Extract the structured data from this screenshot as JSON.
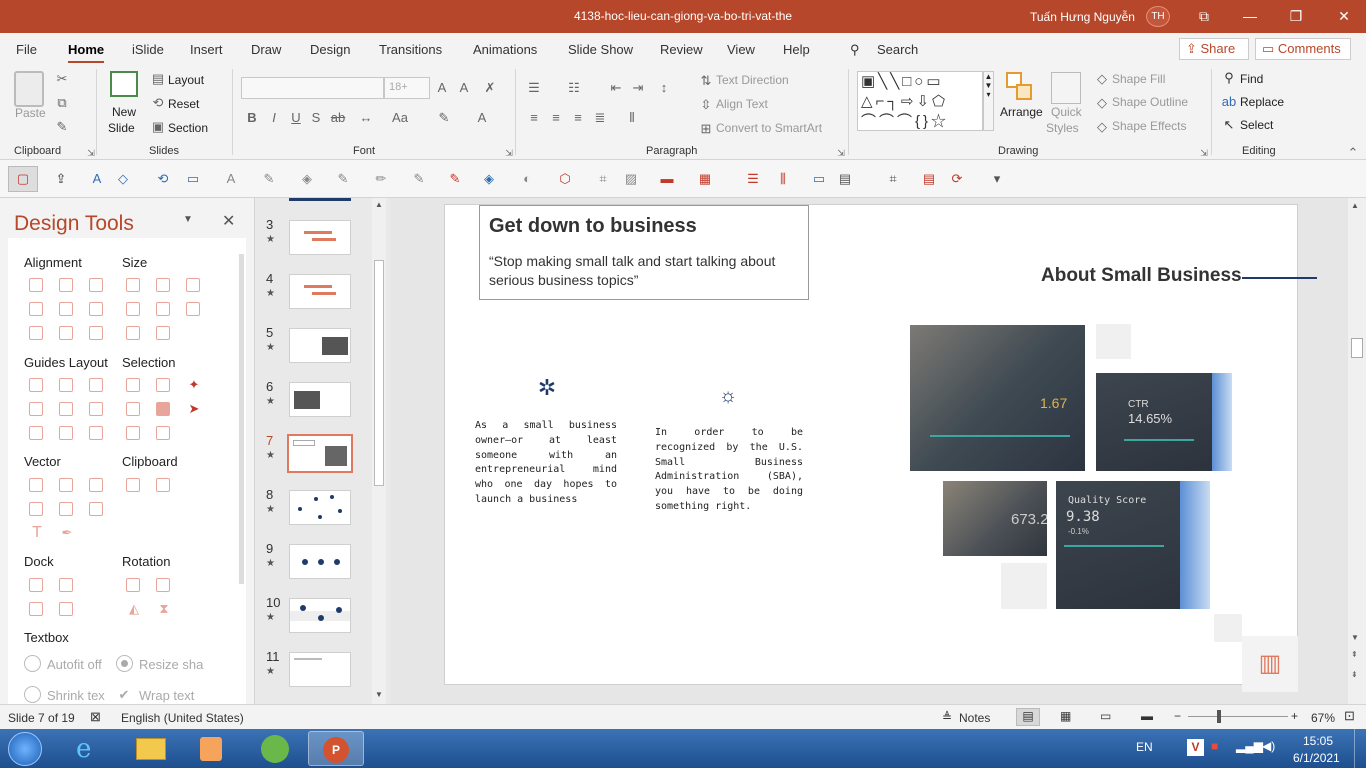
{
  "window": {
    "title": "4138-hoc-lieu-can-giong-va-bo-tri-vat-the",
    "user_name": "Tuấn Hưng Nguyễn",
    "user_initials": "TH"
  },
  "tabs": [
    "File",
    "Home",
    "iSlide",
    "Insert",
    "Draw",
    "Design",
    "Transitions",
    "Animations",
    "Slide Show",
    "Review",
    "View",
    "Help"
  ],
  "search_label": "Search",
  "share_label": "Share",
  "comments_label": "Comments",
  "ribbon": {
    "clipboard": {
      "paste": "Paste",
      "label": "Clipboard"
    },
    "slides": {
      "new_slide_1": "New",
      "new_slide_2": "Slide",
      "layout": "Layout",
      "reset": "Reset",
      "section": "Section",
      "label": "Slides"
    },
    "font": {
      "size_placeholder": "18+",
      "label": "Font"
    },
    "paragraph": {
      "text_direction": "Text Direction",
      "align_text": "Align Text",
      "convert_smartart": "Convert to SmartArt",
      "label": "Paragraph"
    },
    "drawing": {
      "arrange": "Arrange",
      "quick_styles_1": "Quick",
      "quick_styles_2": "Styles",
      "shape_fill": "Shape Fill",
      "shape_outline": "Shape Outline",
      "shape_effects": "Shape Effects",
      "label": "Drawing"
    },
    "editing": {
      "find": "Find",
      "replace": "Replace",
      "select": "Select",
      "label": "Editing"
    }
  },
  "design_tools": {
    "title": "Design Tools",
    "sections": {
      "alignment": "Alignment",
      "size": "Size",
      "guides_layout": "Guides Layout",
      "selection": "Selection",
      "vector": "Vector",
      "clipboard": "Clipboard",
      "dock": "Dock",
      "rotation": "Rotation",
      "textbox": "Textbox"
    },
    "textbox_options": {
      "autofit_off": "Autofit off",
      "resize_shape": "Resize sha",
      "shrink_text": "Shrink tex",
      "wrap_text": "Wrap text"
    }
  },
  "thumbnails": [
    {
      "num": "3",
      "star": "★"
    },
    {
      "num": "4",
      "star": "★"
    },
    {
      "num": "5",
      "star": "★"
    },
    {
      "num": "6",
      "star": "★"
    },
    {
      "num": "7",
      "star": "★"
    },
    {
      "num": "8",
      "star": "★"
    },
    {
      "num": "9",
      "star": "★"
    },
    {
      "num": "10",
      "star": "★"
    },
    {
      "num": "11",
      "star": "★"
    }
  ],
  "slide": {
    "heading": "Get down to business",
    "quote": "“Stop making small talk and start talking about serious business topics”",
    "about_title": "About Small Business",
    "col1_text": "As a small business owner—or at least someone with an entrepreneurial mind who one day hopes to launch a business",
    "col2_text": "In order to be recognized by the U.S. Small Business Administration (SBA), you have to be doing something right.",
    "photo_1_text": "1.67",
    "photo_2_line1": "CTR",
    "photo_2_line2": "14.65%",
    "photo_3_text": "673.2",
    "photo_4_line1": "Quality Score",
    "photo_4_line2": "9.38",
    "photo_4_line3": "-0.1%"
  },
  "status": {
    "slide_of": "Slide 7 of 19",
    "language": "English (United States)",
    "notes": "Notes",
    "zoom": "67%"
  },
  "taskbar": {
    "lang": "EN",
    "time": "15:05",
    "date": "6/1/2021"
  },
  "colors": {
    "accent": "#b7472a",
    "slide_blue": "#1f3a6b",
    "thumb_orange": "#e07a5f"
  }
}
